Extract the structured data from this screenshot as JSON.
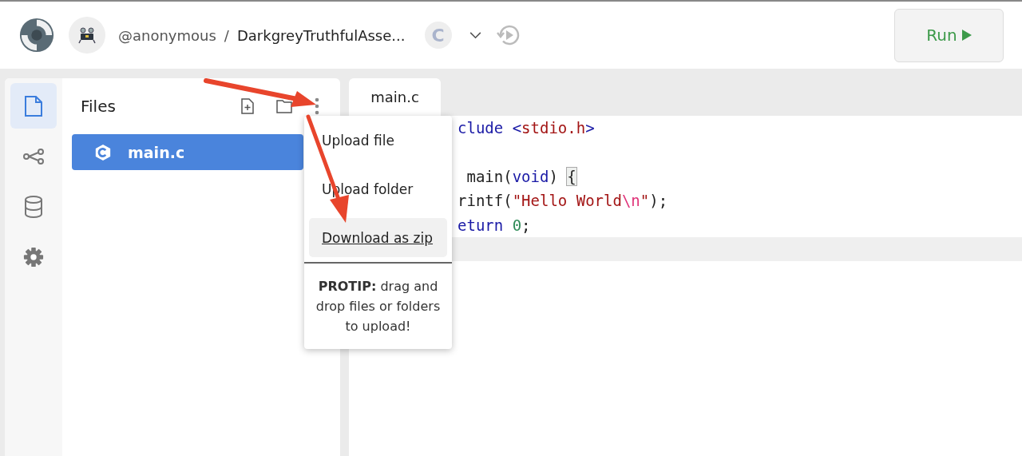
{
  "header": {
    "user": "@anonymous",
    "separator": "/",
    "project": "DarkgreyTruthfulAsse...",
    "language_badge": "C",
    "run_button": "Run"
  },
  "rail": [
    {
      "kind": "file",
      "selected": true
    },
    {
      "kind": "share",
      "selected": false
    },
    {
      "kind": "database",
      "selected": false
    },
    {
      "kind": "settings",
      "selected": false
    }
  ],
  "files": {
    "title": "Files",
    "items": [
      {
        "name": "main.c",
        "selected": true
      }
    ]
  },
  "editor": {
    "tabs": [
      {
        "label": "main.c",
        "selected": true
      }
    ],
    "lines": [
      {
        "current": false,
        "tokens": [
          {
            "kind": "keyword",
            "text": "clude"
          },
          {
            "kind": "keyword",
            "text": " <"
          },
          {
            "kind": "string",
            "text": "stdio.h"
          },
          {
            "kind": "keyword",
            "text": ">"
          }
        ]
      },
      {
        "current": false
      },
      {
        "current": false,
        "tokens": [
          {
            "kind": "plain",
            "text": " main("
          },
          {
            "kind": "keyword",
            "text": "void"
          },
          {
            "kind": "plain",
            "text": ") "
          },
          {
            "kind": "bracket",
            "text": "{"
          }
        ]
      },
      {
        "current": false,
        "tokens": [
          {
            "kind": "plain",
            "text": "rintf("
          },
          {
            "kind": "string",
            "text": "\"Hello World"
          },
          {
            "kind": "escape",
            "text": "\\n"
          },
          {
            "kind": "string",
            "text": "\""
          },
          {
            "kind": "plain",
            "text": ");"
          }
        ]
      },
      {
        "current": false,
        "tokens": [
          {
            "kind": "keyword",
            "text": "eturn"
          },
          {
            "kind": "number",
            "text": " 0"
          },
          {
            "kind": "plain",
            "text": ";"
          }
        ]
      },
      {
        "current": true
      }
    ]
  },
  "menu": {
    "items": [
      {
        "label": "Upload file",
        "highlighted": false
      },
      {
        "label": "Upload folder",
        "highlighted": false
      },
      {
        "label": "Download as zip",
        "highlighted": true
      }
    ],
    "protip": "**PROTIP:** drag and drop files or folders to upload!"
  }
}
